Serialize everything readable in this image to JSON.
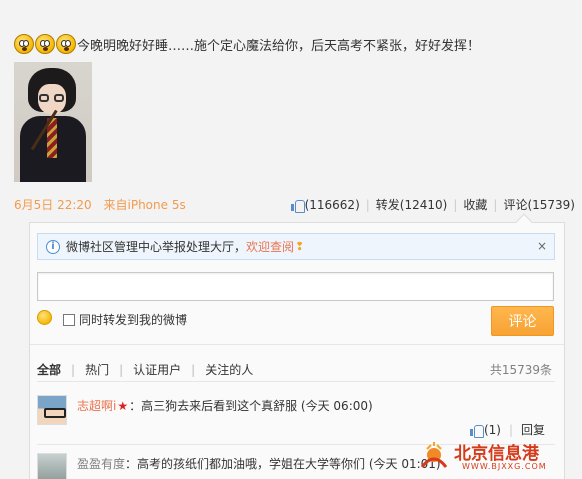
{
  "post": {
    "text": "今晚明晚好好睡……施个定心魔法给你，后天高考不紧张，好好发挥！",
    "emojis": [
      "shock-face-icon",
      "shock-face-icon",
      "shock-face-icon"
    ]
  },
  "meta": {
    "date": "6月5日 22:20",
    "source": "来自iPhone 5s"
  },
  "actions": {
    "like": "(116662)",
    "repost": "转发(12410)",
    "favorite": "收藏",
    "comment": "评论(15739)"
  },
  "notice": {
    "text": "微博社区管理中心举报处理大厅，",
    "link": "欢迎查阅",
    "close": "×"
  },
  "composer": {
    "placeholder": "",
    "repost_label": "同时转发到我的微博",
    "submit_label": "评论"
  },
  "tabs": {
    "items": [
      "全部",
      "热门",
      "认证用户",
      "关注的人"
    ],
    "total": "共15739条"
  },
  "comments": [
    {
      "user": "志超啊i",
      "text": "：高三狗去来后看到这个真舒服 (今天 06:00)",
      "like": "(1)",
      "reply": "回复"
    },
    {
      "user": "盈盈有度",
      "text": "：高考的孩纸们都加油哦，学姐在大学等你们 (今天 01:01)"
    }
  ],
  "watermark": {
    "title": "北京信息港",
    "url": "WWW.BJXXG.COM"
  },
  "colors": {
    "accent": "#eb7350",
    "meta": "#f39b4e",
    "button": "#f7a234",
    "link_blue": "#4a8ed0"
  }
}
